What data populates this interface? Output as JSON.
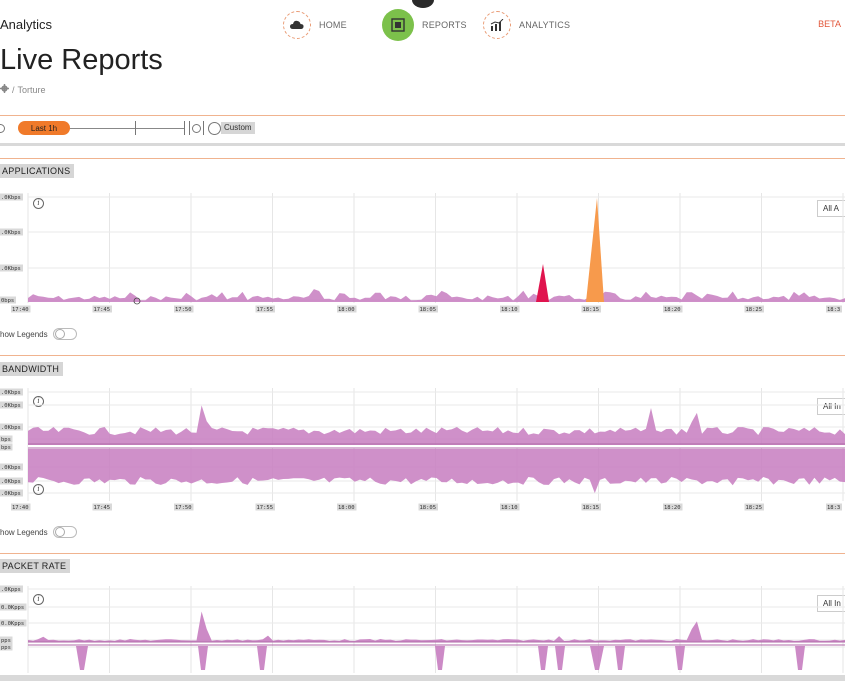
{
  "header": {
    "app_title": "Analytics",
    "beta_label": "BETA",
    "nav": [
      {
        "label": "HOME",
        "icon": "cloud-icon"
      },
      {
        "label": "REPORTS",
        "icon": "report-icon",
        "active": true
      },
      {
        "label": "ANALYTICS",
        "icon": "bar-chart-icon"
      }
    ]
  },
  "page": {
    "title": "Live Reports",
    "breadcrumb": [
      "/",
      "Torture"
    ]
  },
  "range": {
    "selected": "Last 1h",
    "custom": "Custom"
  },
  "colors": {
    "accent": "#f07a2a",
    "nav_active": "#7cc14b",
    "divider": "#f0b38f",
    "series_purple": "#c77dc0",
    "series_orange": "#f79a4c",
    "series_red": "#e0144e"
  },
  "sections": {
    "applications": {
      "title": "APPLICATIONS",
      "filter": "All A",
      "legend_toggle": "how Legends",
      "yticks": [
        ".0Kbps",
        ".0Kbps",
        ".0Kbps",
        "0bps"
      ]
    },
    "bandwidth": {
      "title": "BANDWIDTH",
      "filter": "All In",
      "legend_toggle": "how Legends",
      "yticks": [
        ".0Kbps",
        ".0Kbps",
        ".0Kbps",
        "bps",
        "bps",
        ".0Kbps",
        ".0Kbps",
        ".0Kbps"
      ]
    },
    "packet_rate": {
      "title": "PACKET RATE",
      "filter": "All In",
      "yticks": [
        ".0Kpps",
        "0.0Kpps",
        "0.0Kpps",
        "pps",
        "pps"
      ]
    }
  },
  "chart_data": [
    {
      "type": "area",
      "title": "APPLICATIONS",
      "xlabel": "",
      "ylabel": "",
      "categories": [
        "17:40",
        "17:45",
        "17:50",
        "17:55",
        "18:00",
        "18:05",
        "18:10",
        "18:15",
        "18:20",
        "18:25",
        "18:3"
      ],
      "series": [
        {
          "color": "#c77dc0",
          "values": [
            1,
            1,
            1,
            1,
            1,
            1,
            1,
            1,
            1,
            1,
            1
          ]
        },
        {
          "color": "#e0144e",
          "values": [
            0,
            0,
            0,
            0,
            0,
            0,
            3.5,
            0,
            0,
            0,
            0
          ]
        },
        {
          "color": "#f79a4c",
          "values": [
            0,
            0,
            0,
            0,
            0,
            0,
            0,
            10,
            0,
            0,
            0
          ]
        }
      ]
    },
    {
      "type": "area",
      "title": "BANDWIDTH",
      "xlabel": "",
      "ylabel": "",
      "categories": [
        "17:40",
        "17:45",
        "17:50",
        "17:55",
        "18:00",
        "18:05",
        "18:10",
        "18:15",
        "18:20",
        "18:25",
        "18:3"
      ],
      "series": [
        {
          "color": "#c77dc0",
          "values": [
            1,
            1,
            3,
            1,
            1,
            1,
            1,
            1,
            2.2,
            1,
            1
          ]
        },
        {
          "color": "#c77dc0",
          "values": [
            -3,
            -3,
            -3,
            -3,
            -3,
            -3,
            -3,
            -3.6,
            -3,
            -3,
            -3
          ]
        }
      ]
    },
    {
      "type": "area",
      "title": "PACKET RATE",
      "xlabel": "",
      "ylabel": "",
      "categories": [
        "17:40",
        "17:45",
        "17:50",
        "17:55",
        "18:00",
        "18:05",
        "18:10",
        "18:15",
        "18:20",
        "18:25",
        "18:3"
      ],
      "series": [
        {
          "color": "#c77dc0",
          "values": [
            0.5,
            0.5,
            4,
            0.5,
            0.5,
            0.5,
            0.5,
            0.5,
            3,
            0.5,
            0.5
          ]
        },
        {
          "color": "#c77dc0",
          "values": [
            -2,
            -2,
            -2,
            -2,
            0,
            -2,
            -2,
            -2,
            -2,
            -2,
            0
          ]
        }
      ]
    }
  ]
}
